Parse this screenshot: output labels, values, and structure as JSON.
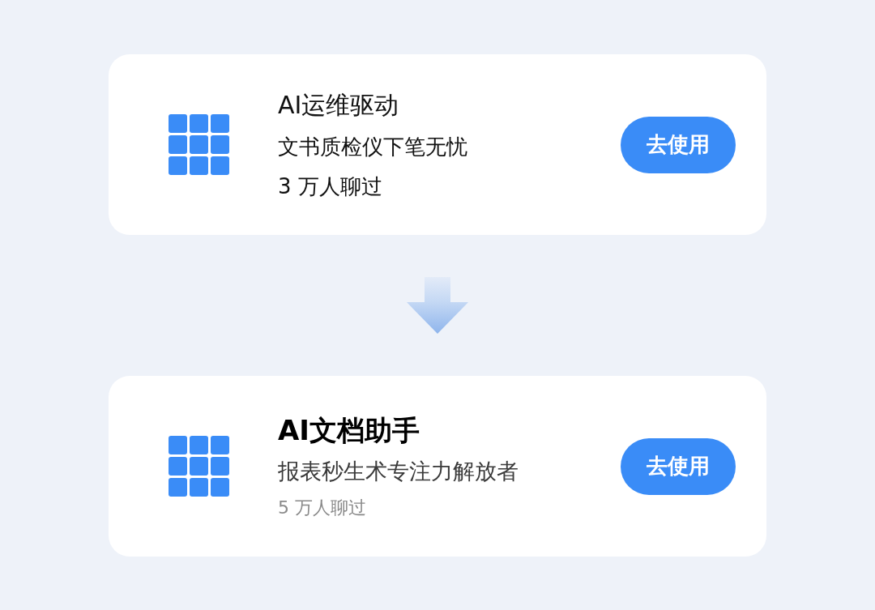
{
  "cards": [
    {
      "kind": "plain",
      "title": "AI运维驱动",
      "subtitle": "文书质检仪下笔无忧",
      "users": "3 万人聊过",
      "button": "去使用"
    },
    {
      "kind": "refined",
      "title": "AI文档助手",
      "subtitle": "报表秒生术专注力解放者",
      "users": "5 万人聊过",
      "button": "去使用"
    }
  ]
}
